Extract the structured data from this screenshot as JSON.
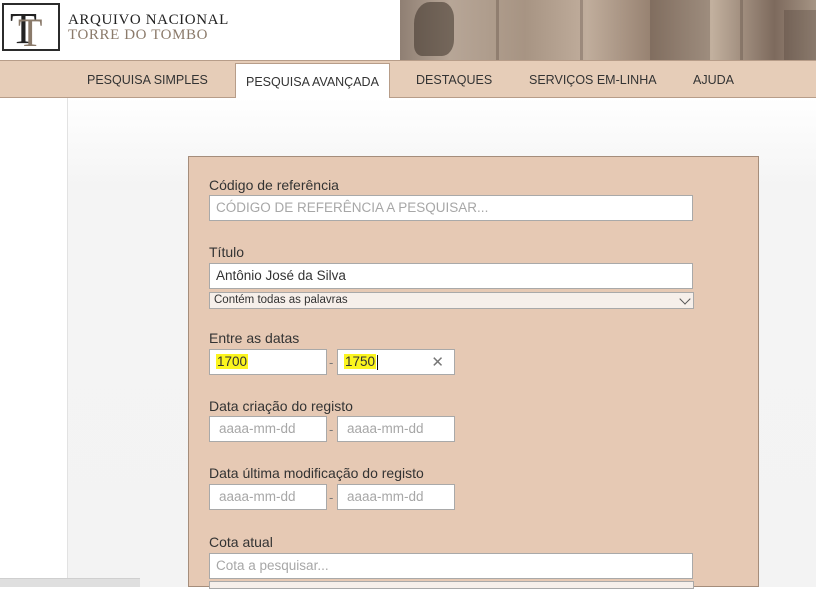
{
  "brand": {
    "line1": "ARQUIVO NACIONAL",
    "line2": "TORRE DO TOMBO",
    "logo_letter": "T"
  },
  "nav": {
    "items": [
      {
        "label": "PESQUISA SIMPLES"
      },
      {
        "label": "PESQUISA AVANÇADA",
        "active": true
      },
      {
        "label": "DESTAQUES"
      },
      {
        "label": "SERVIÇOS EM-LINHA"
      },
      {
        "label": "AJUDA"
      }
    ]
  },
  "form": {
    "reference_code": {
      "label": "Código de referência",
      "placeholder": "CÓDIGO DE REFERÊNCIA A PESQUISAR..."
    },
    "title": {
      "label": "Título",
      "value": "Antônio José da Silva",
      "match_mode": "Contém todas as palavras"
    },
    "date_range": {
      "label": "Entre as datas",
      "from": "1700",
      "to": "1750",
      "separator": "-"
    },
    "record_created": {
      "label": "Data criação do registo",
      "from_placeholder": "aaaa-mm-dd",
      "to_placeholder": "aaaa-mm-dd",
      "separator": "-"
    },
    "record_modified": {
      "label": "Data última modificação do registo",
      "from_placeholder": "aaaa-mm-dd",
      "to_placeholder": "aaaa-mm-dd",
      "separator": "-"
    },
    "shelfmark": {
      "label": "Cota atual",
      "placeholder": "Cota a pesquisar..."
    }
  },
  "icons": {
    "clear": "close-icon",
    "dropdown": "chevron-down-icon"
  },
  "colors": {
    "nav_bg": "#e6cdb8",
    "panel_bg": "#e6c9b4",
    "highlight": "#fbf51f"
  }
}
